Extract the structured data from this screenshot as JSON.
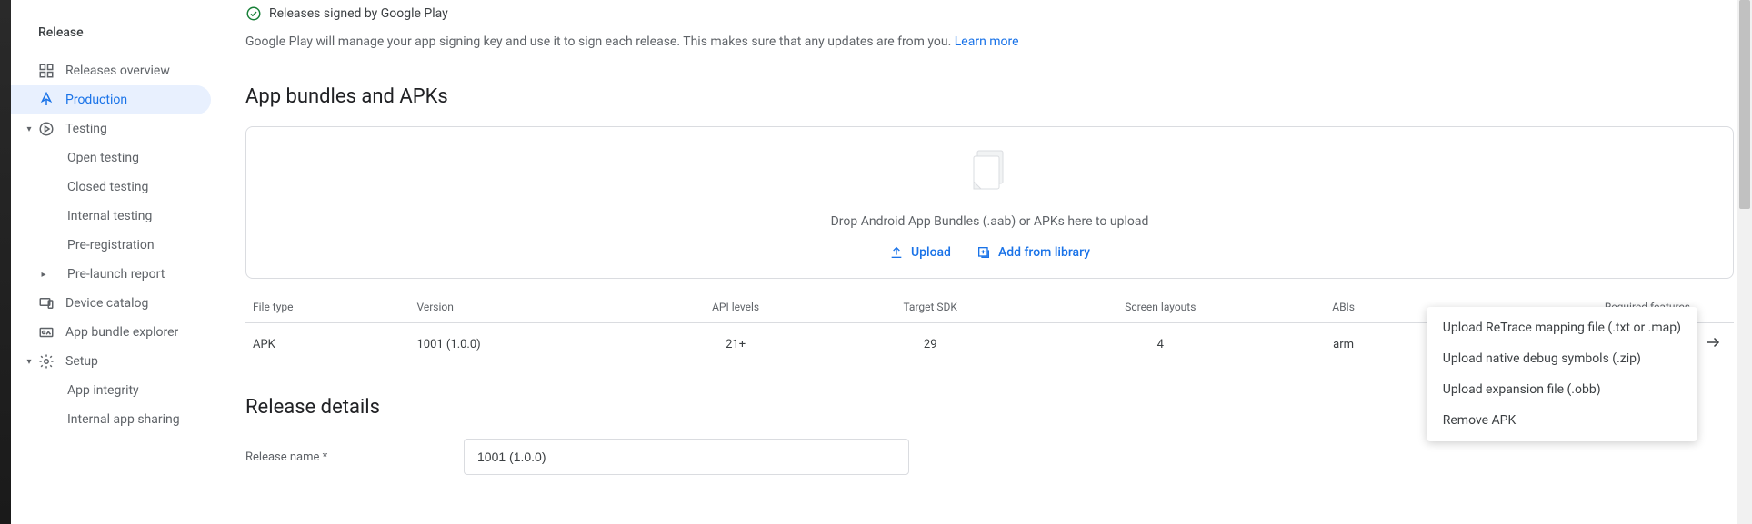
{
  "sidebar": {
    "section": "Release",
    "items": [
      {
        "label": "Releases overview",
        "icon": "dashboard"
      },
      {
        "label": "Production",
        "icon": "production",
        "selected": true
      },
      {
        "label": "Testing",
        "icon": "testing",
        "expandable": true,
        "expanded": true
      },
      {
        "label": "Open testing",
        "child": true
      },
      {
        "label": "Closed testing",
        "child": true
      },
      {
        "label": "Internal testing",
        "child": true
      },
      {
        "label": "Pre-registration",
        "child": true
      },
      {
        "label": "Pre-launch report",
        "child_expand": true
      },
      {
        "label": "Device catalog",
        "icon": "devices"
      },
      {
        "label": "App bundle explorer",
        "icon": "bundle"
      },
      {
        "label": "Setup",
        "icon": "gear",
        "expandable": true,
        "expanded": true
      },
      {
        "label": "App integrity",
        "child": true
      },
      {
        "label": "Internal app sharing",
        "child": true
      }
    ]
  },
  "signing": {
    "title": "Releases signed by Google Play",
    "desc": "Google Play will manage your app signing key and use it to sign each release. This makes sure that any updates are from you. ",
    "learn_more": "Learn more"
  },
  "bundles": {
    "heading": "App bundles and APKs",
    "drop_text": "Drop Android App Bundles (.aab) or APKs here to upload",
    "upload_btn": "Upload",
    "library_btn": "Add from library",
    "columns": [
      "File type",
      "Version",
      "API levels",
      "Target SDK",
      "Screen layouts",
      "ABIs",
      "Required features"
    ],
    "row": {
      "file_type": "APK",
      "version": "1001 (1.0.0)",
      "api_levels": "21+",
      "target_sdk": "29",
      "screen_layouts": "4",
      "abis": "arm",
      "required_features": ""
    }
  },
  "release_details": {
    "heading": "Release details",
    "name_label": "Release name  *",
    "name_value": "1001 (1.0.0)"
  },
  "context_menu": {
    "items": [
      "Upload ReTrace mapping file (.txt or .map)",
      "Upload native debug symbols (.zip)",
      "Upload expansion file (.obb)",
      "Remove APK"
    ]
  }
}
